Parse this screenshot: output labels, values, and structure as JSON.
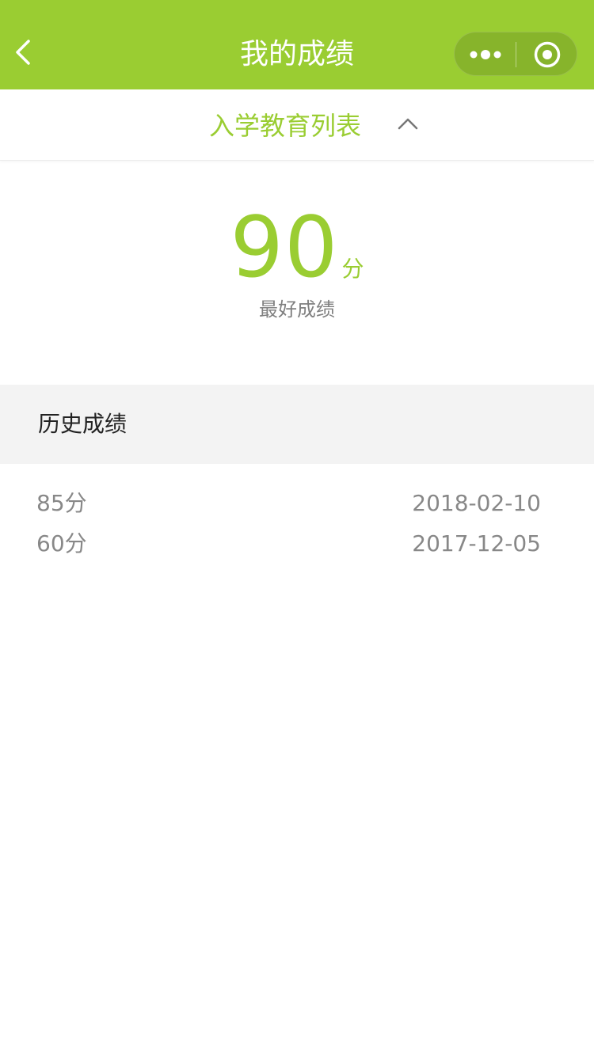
{
  "navbar": {
    "title": "我的成绩",
    "back_icon": "chevron-left-icon",
    "more_icon": "more-dots-icon",
    "close_icon": "target-close-icon",
    "background": "#9acd32"
  },
  "list_toggle": {
    "label": "入学教育列表",
    "icon": "chevron-up-icon"
  },
  "best": {
    "score": "90",
    "unit": "分",
    "label": "最好成绩"
  },
  "history": {
    "title": "历史成绩",
    "rows": [
      {
        "score": "85分",
        "date": "2018-02-10"
      },
      {
        "score": "60分",
        "date": "2017-12-05"
      }
    ]
  },
  "colors": {
    "accent": "#9acd32",
    "muted_text": "#888888",
    "section_bg": "#f3f3f3"
  }
}
